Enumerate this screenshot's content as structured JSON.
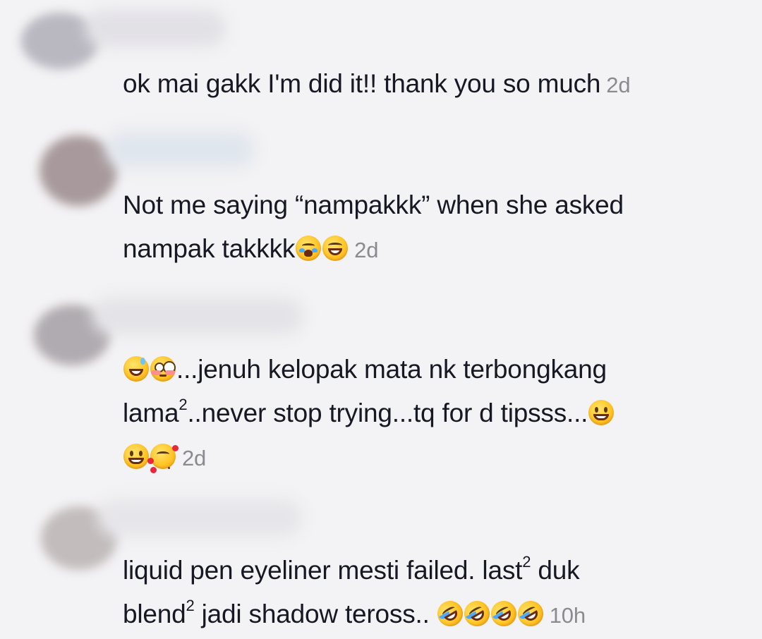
{
  "comments": [
    {
      "text": "ok mai gakk I'm did it!! thank you so much",
      "time": "2d",
      "avatar_color": "#b9b7c0",
      "username_color": "#e2e1e6"
    },
    {
      "text_line1": "Not me saying “nampakkk” when she asked",
      "text_line2": "nampak takkkk",
      "emojis": [
        "loudly-crying-face",
        "face-with-tears-of-joy"
      ],
      "time": "2d",
      "avatar_color": "#a89a9c",
      "username_color": "#e0e6ee"
    },
    {
      "text_line1": "...jenuh kelopak mata nk terbongkang",
      "text_line2_a": "lama",
      "text_line2_sup": "2",
      "text_line2_b": "..never stop trying...tq for d tipsss...",
      "emojis": [
        "grinning-face-with-sweat",
        "flushed-face",
        "beaming-face",
        "beaming-face",
        "smiling-face-with-hearts"
      ],
      "time": "2d",
      "avatar_color": "#b0abb0",
      "username_color": "#e4e3e7"
    },
    {
      "text_line1_a": "liquid pen eyeliner mesti failed. last",
      "text_line1_sup": "2",
      "text_line1_b": " duk",
      "text_line2_a": "blend",
      "text_line2_sup": "2",
      "text_line2_b": " jadi shadow teross.. ",
      "emojis": [
        "rolling-on-the-floor-laughing",
        "rolling-on-the-floor-laughing",
        "rolling-on-the-floor-laughing",
        "rolling-on-the-floor-laughing"
      ],
      "time": "10h",
      "avatar_color": "#c2bcbc",
      "username_color": "#e6e5e9"
    }
  ]
}
